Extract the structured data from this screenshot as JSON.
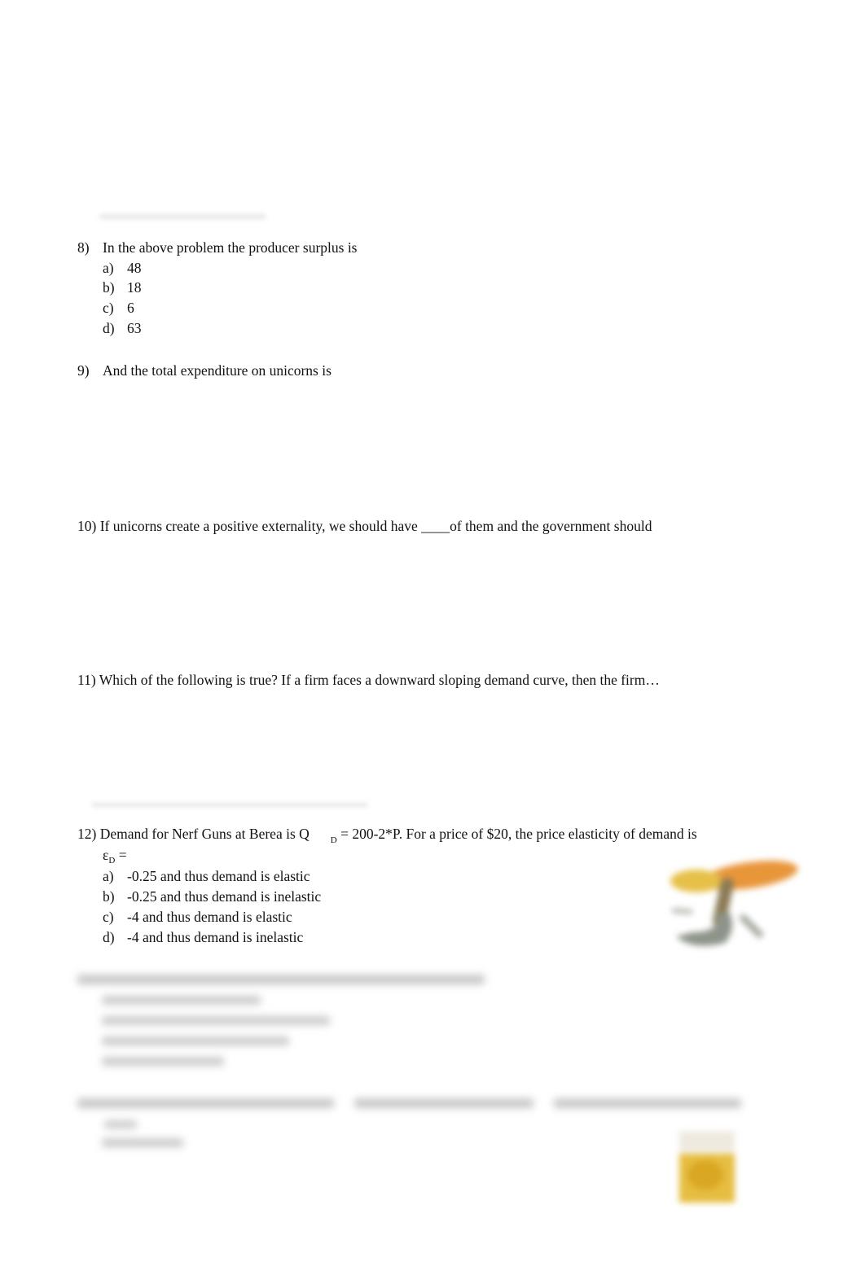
{
  "document": {
    "questions": [
      {
        "number": "8)",
        "text": "In the above problem the producer surplus is",
        "options": [
          {
            "letter": "a)",
            "text": "48"
          },
          {
            "letter": "b)",
            "text": "18"
          },
          {
            "letter": "c)",
            "text": "6"
          },
          {
            "letter": "d)",
            "text": "63"
          }
        ]
      },
      {
        "number": "9)",
        "text": "And the total expenditure on unicorns is"
      },
      {
        "number": "10)",
        "text": "If unicorns create a positive externality, we should have ____of them and the government should"
      },
      {
        "number": "11)",
        "text": "Which of the following is true? If a firm faces a downward sloping demand curve, then the firm…"
      },
      {
        "number": "12)",
        "text_before_sub": "Demand for Nerf Guns at Berea is Q",
        "subscript": "D",
        "text_after_sub": "= 200-2*P. For a price of $20, the price elasticity of demand is",
        "continuation_symbol": "ε",
        "continuation_sub": "D",
        "continuation_after": "=",
        "options": [
          {
            "letter": "a)",
            "text": "-0.25 and thus demand is elastic"
          },
          {
            "letter": "b)",
            "text": "-0.25 and thus demand is inelastic"
          },
          {
            "letter": "c)",
            "text": "-4 and thus demand is elastic"
          },
          {
            "letter": "d)",
            "text": "-4 and thus demand is inelastic"
          }
        ]
      }
    ],
    "images": {
      "nerf_gun": "nerf-gun-image",
      "bottom_product": "product-image"
    },
    "colors": {
      "text": "#111111",
      "blur_gray": "#d8d8d8",
      "nerf_orange": "#e8a040",
      "nerf_gray": "#8a8f86",
      "product_yellow": "#e8b830"
    }
  }
}
